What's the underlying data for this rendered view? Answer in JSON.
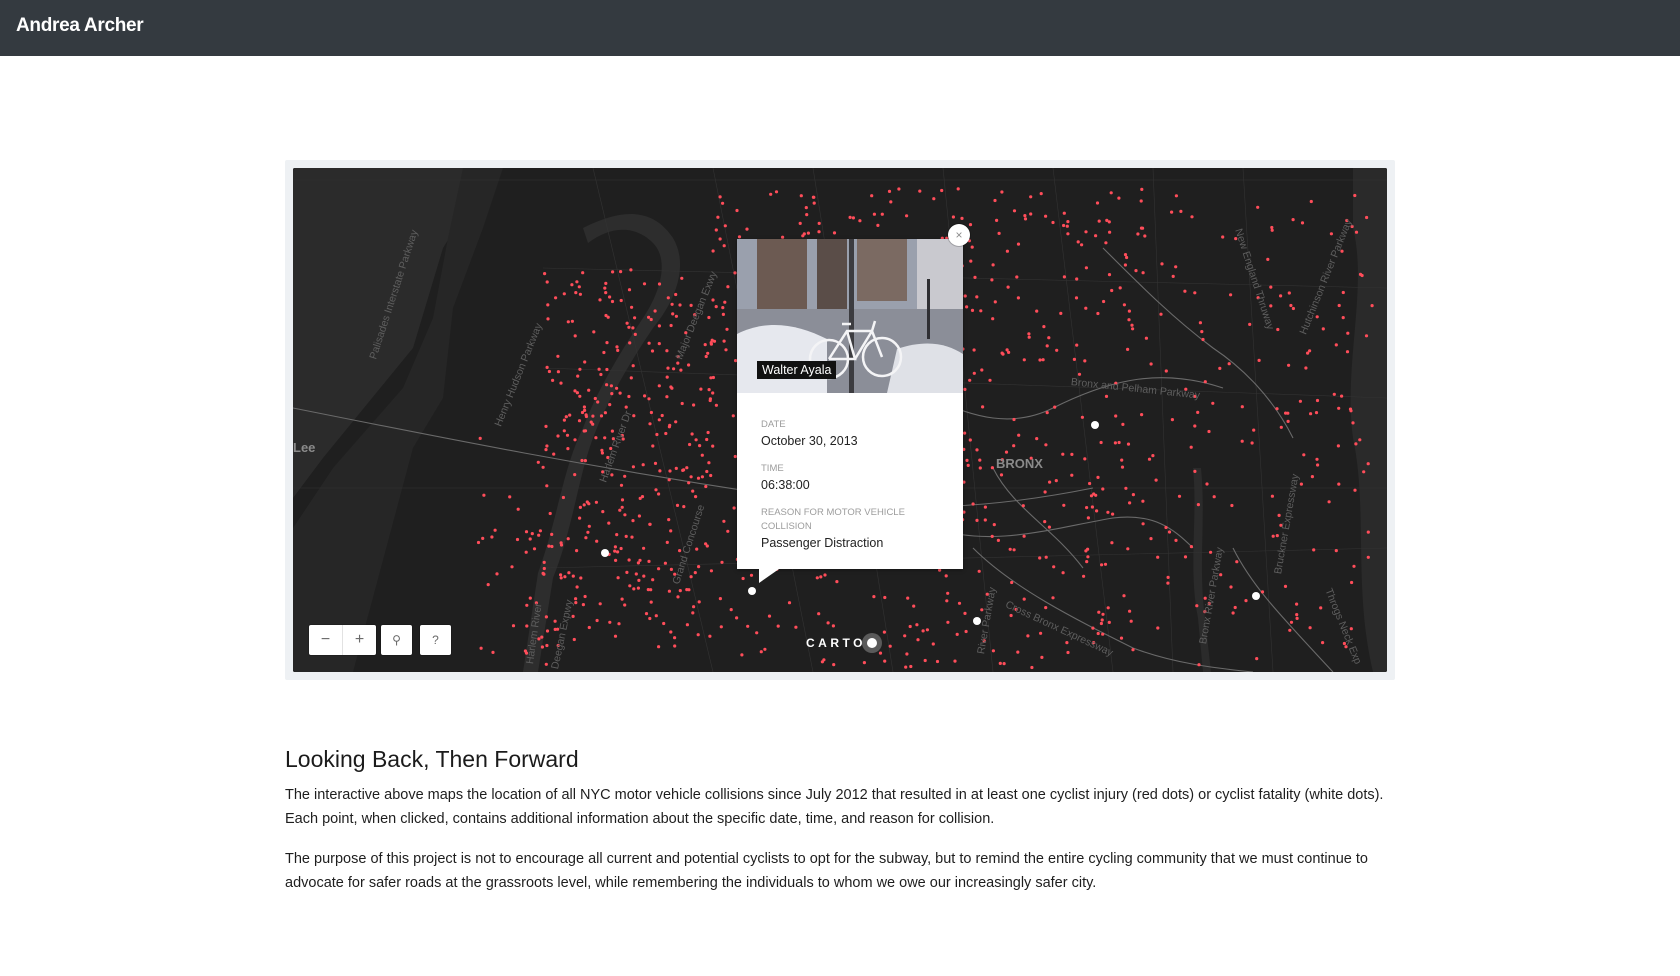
{
  "header": {
    "brand": "Andrea Archer"
  },
  "map": {
    "labels": {
      "lee": "Lee",
      "bronx": "BRONX",
      "palisades": "Palisades Interstate Parkway",
      "henry_hudson": "Henry Hudson Parkway",
      "harlem_river_dr": "Harlem River Dr",
      "major_deegan": "Major Deegan Exwy",
      "grand_concourse": "Grand Concourse",
      "harlem_river": "Harlem River",
      "deegan_expwy": "Deegan Expwy",
      "bronx_pelham": "Bronx and Pelham Parkway",
      "cross_bronx": "Cross Bronx Expressway",
      "bronx_river": "Bronx River Parkway",
      "bruckner": "Bruckner Expressway",
      "new_england": "New England Thruway",
      "hutchinson": "Hutchinson River Parkway",
      "throgs_neck": "Throgs Neck Exp",
      "river_parkway": "River Parkway"
    },
    "colors": {
      "water": "#2b2b2b",
      "land": "#1f1f1f",
      "roads": "#3b3b3b",
      "injury_dot": "#ff4d5a",
      "fatality_dot": "#ffffff"
    },
    "controls": {
      "zoom_out": "−",
      "zoom_in": "+",
      "search_icon": "⚲",
      "help": "?"
    },
    "attribution": "CARTO",
    "popup": {
      "image_caption": "Walter Ayala",
      "close": "×",
      "date_label": "DATE",
      "date_value": "October 30, 2013",
      "time_label": "TIME",
      "time_value": "06:38:00",
      "reason_label": "REASON FOR MOTOR VEHICLE COLLISION",
      "reason_value": "Passenger Distraction"
    }
  },
  "article": {
    "title": "Looking Back, Then Forward",
    "paragraph1": "The interactive above maps the location of all NYC motor vehicle collisions since July 2012 that resulted in at least one cyclist injury (red dots) or cyclist fatality (white dots). Each point, when clicked, contains additional information about the specific date, time, and reason for collision.",
    "paragraph2": "The purpose of this project is not to encourage all current and potential cyclists to opt for the subway, but to remind the entire cycling community that we must continue to advocate for safer roads at the grassroots level, while remembering the individuals to whom we owe our increasingly safer city."
  }
}
